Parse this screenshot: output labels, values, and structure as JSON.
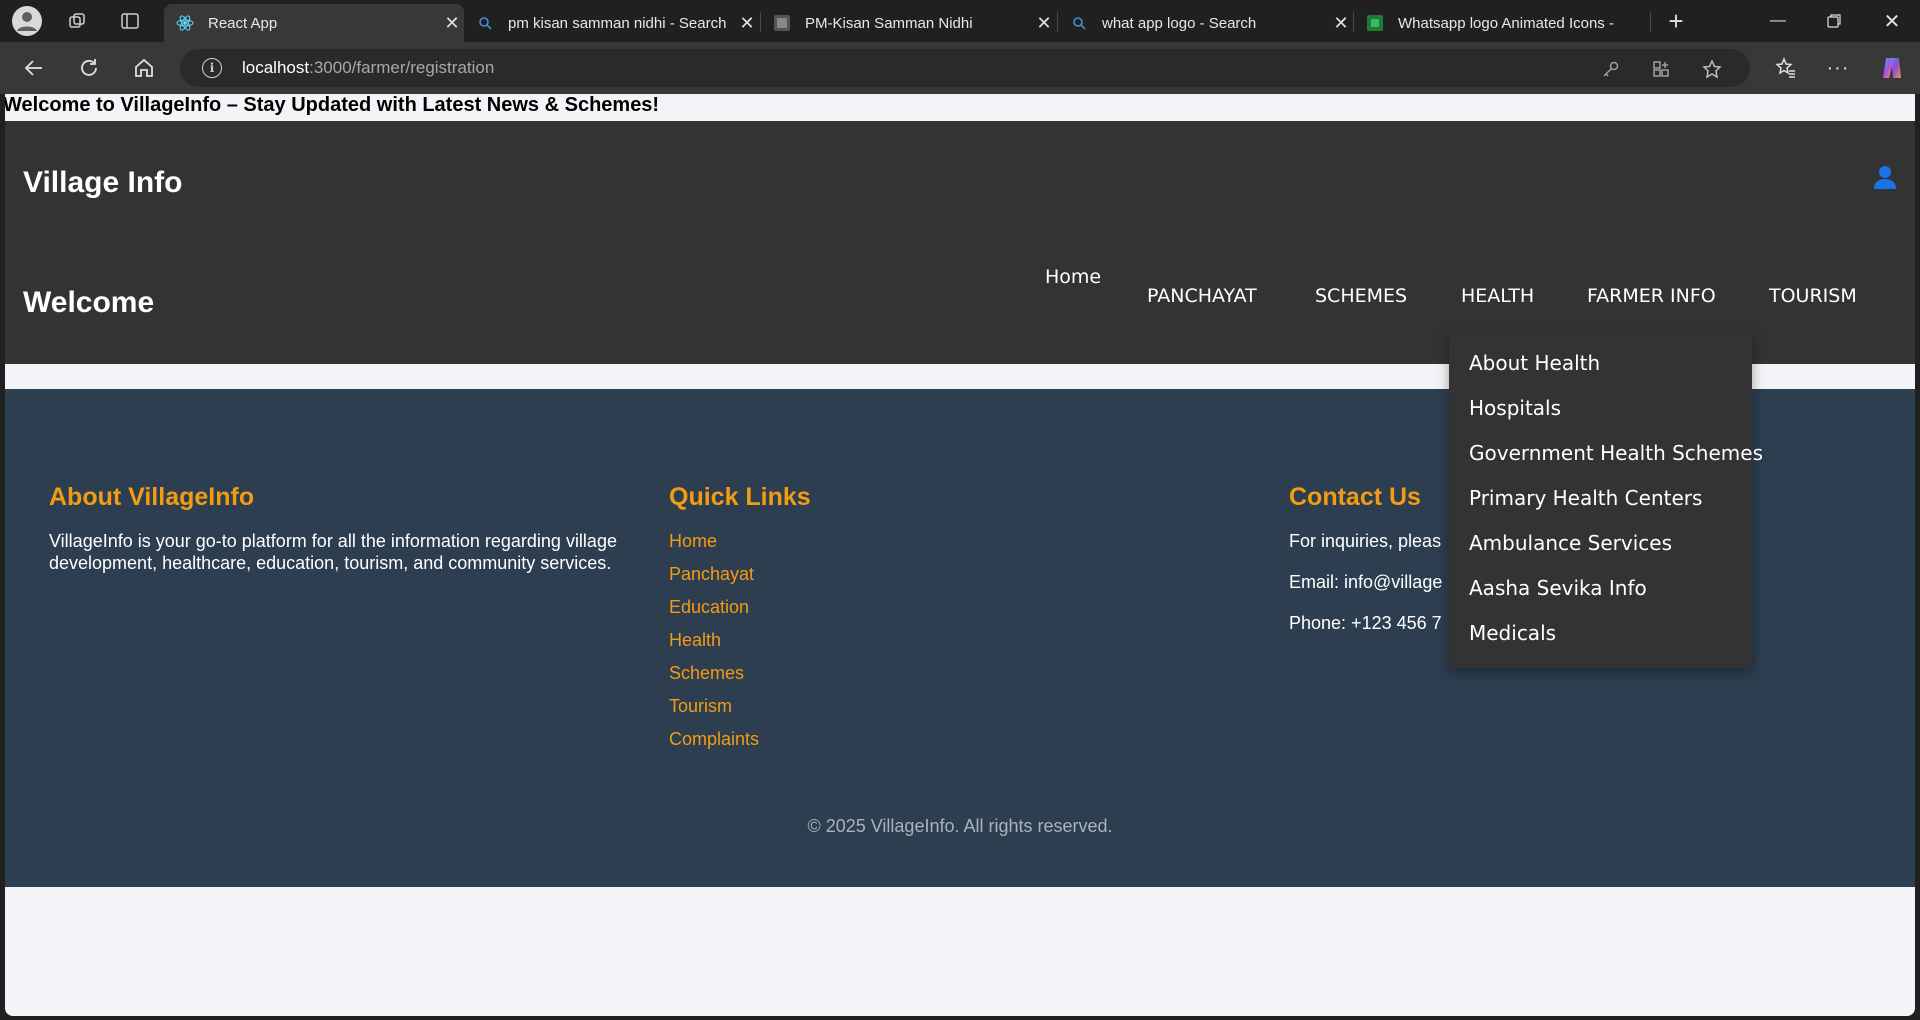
{
  "browser": {
    "tabs": [
      {
        "title": "React App",
        "icon": "react-icon",
        "active": true
      },
      {
        "title": "pm kisan samman nidhi - Search",
        "icon": "search-icon",
        "active": false
      },
      {
        "title": "PM-Kisan Samman Nidhi",
        "icon": "site-favicon",
        "active": false
      },
      {
        "title": "what app logo - Search",
        "icon": "search-icon",
        "active": false
      },
      {
        "title": "Whatsapp logo Animated Icons -",
        "icon": "site-favicon-green",
        "active": false
      }
    ],
    "url_host": "localhost",
    "url_path": ":3000/farmer/registration"
  },
  "page": {
    "marquee": "Welcome to VillageInfo – Stay Updated with Latest News & Schemes!",
    "brand": "Village Info",
    "welcome": "Welcome",
    "nav": {
      "home": "Home",
      "panchayat": "PANCHAYAT",
      "schemes": "SCHEMES",
      "health": "HEALTH",
      "farmer_info": "FARMER INFO",
      "tourism": "TOURISM"
    },
    "health_dropdown": [
      "About Health",
      "Hospitals",
      "Government Health Schemes",
      "Primary Health Centers",
      "Ambulance Services",
      "Aasha Sevika Info",
      "Medicals"
    ],
    "footer": {
      "about_heading": "About VillageInfo",
      "about_text": "VillageInfo is your go-to platform for all the information regarding village development, healthcare, education, tourism, and community services.",
      "links_heading": "Quick Links",
      "links": [
        "Home",
        "Panchayat",
        "Education",
        "Health",
        "Schemes",
        "Tourism",
        "Complaints"
      ],
      "contact_heading": "Contact Us",
      "contact_lines": [
        "For inquiries, pleas",
        "Email: info@village",
        "Phone: +123 456 7"
      ],
      "copyright": "© 2025 VillageInfo. All rights reserved."
    },
    "colors": {
      "header_bg": "#333333",
      "footer_bg": "#2c3e50",
      "accent": "#f39c12",
      "user_icon": "#1a73e8"
    }
  }
}
